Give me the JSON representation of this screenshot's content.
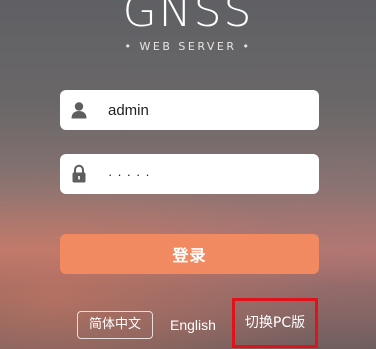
{
  "brand": {
    "title": "GNSS",
    "subtitle": "• WEB SERVER •"
  },
  "login_form": {
    "username": {
      "value": "admin",
      "icon": "user-icon"
    },
    "password": {
      "value": "·····",
      "icon": "lock-icon"
    },
    "submit_label": "登录"
  },
  "footer": {
    "lang_chinese": "简体中文",
    "lang_english": "English",
    "switch_pc": "切换PC版"
  },
  "colors": {
    "accent": "#f28a61",
    "highlight_border": "#e0121b",
    "icon": "#5e5e5e"
  }
}
